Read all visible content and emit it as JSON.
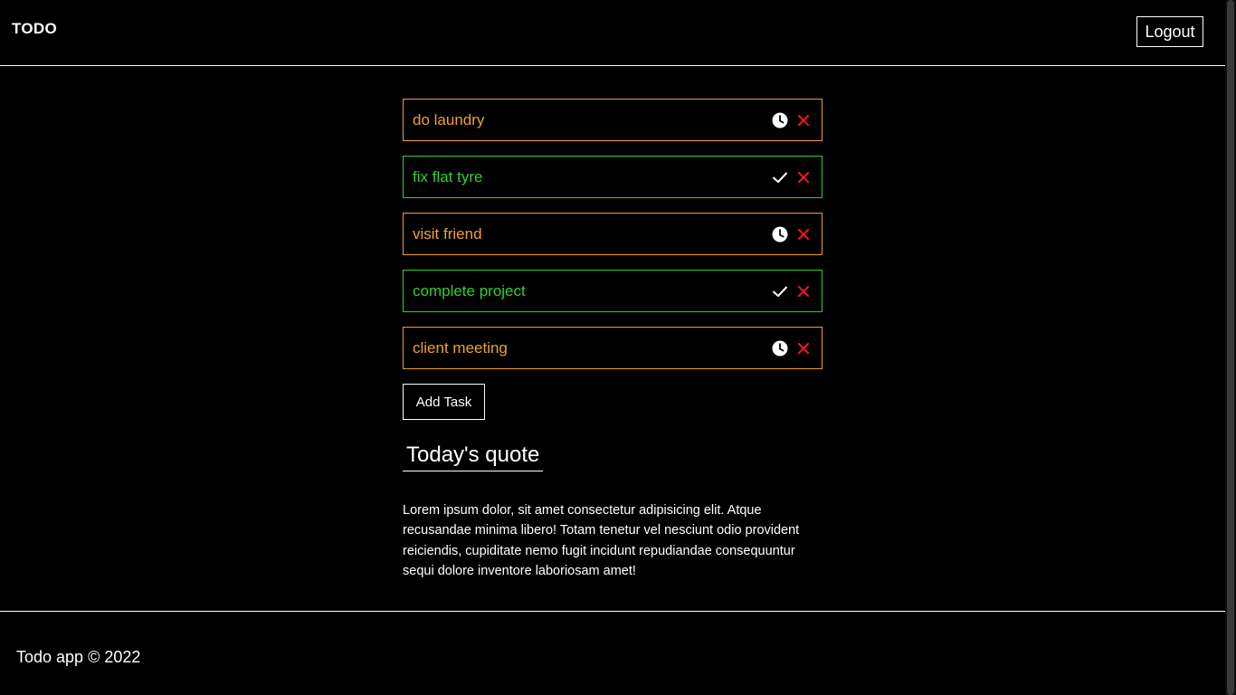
{
  "header": {
    "brand": "TODO",
    "logout_label": "Logout"
  },
  "tasks": [
    {
      "label": "do laundry",
      "status": "pending",
      "status_icon": "clock-icon",
      "color": "#f0a030"
    },
    {
      "label": "fix flat tyre",
      "status": "done",
      "status_icon": "check-icon",
      "color": "#2fd02f"
    },
    {
      "label": "visit friend",
      "status": "pending",
      "status_icon": "clock-icon",
      "color": "#f0a030"
    },
    {
      "label": "complete project",
      "status": "done",
      "status_icon": "check-icon",
      "color": "#2fd02f"
    },
    {
      "label": "client meeting",
      "status": "pending",
      "status_icon": "clock-icon",
      "color": "#f0a030"
    }
  ],
  "add_task_label": "Add Task",
  "quote": {
    "title": "Today's quote",
    "text": "Lorem ipsum dolor, sit amet consectetur adipisicing elit. Atque recusandae minima libero! Totam tenetur vel nesciunt odio provident reiciendis, cupiditate nemo fugit incidunt repudiandae consequuntur sequi dolore inventore laboriosam amet!"
  },
  "footer": {
    "copyright": "Todo app © 2022"
  },
  "colors": {
    "background": "#000000",
    "pending": "#f0a030",
    "done": "#2fd02f",
    "delete": "#e01b1b"
  }
}
